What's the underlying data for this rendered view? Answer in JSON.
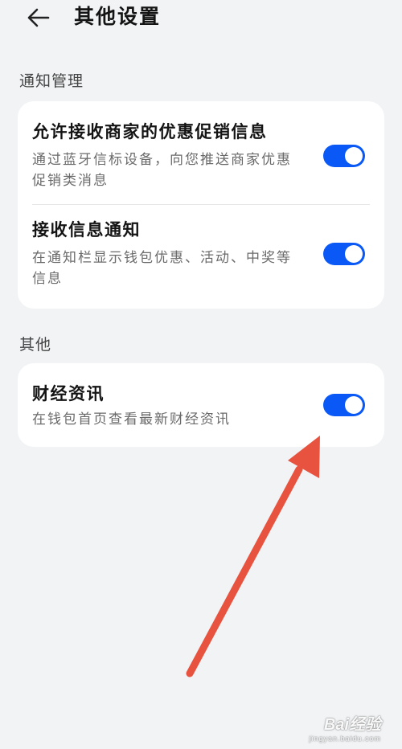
{
  "header": {
    "title": "其他设置",
    "back_icon": "arrow-left-icon"
  },
  "sections": [
    {
      "title": "通知管理",
      "items": [
        {
          "title": "允许接收商家的优惠促销信息",
          "description": "通过蓝牙信标设备，向您推送商家优惠促销类消息",
          "enabled": true
        },
        {
          "title": "接收信息通知",
          "description": "在通知栏显示钱包优惠、活动、中奖等信息",
          "enabled": true
        }
      ]
    },
    {
      "title": "其他",
      "items": [
        {
          "title": "财经资讯",
          "description": "在钱包首页查看最新财经资讯",
          "enabled": true
        }
      ]
    }
  ],
  "annotation": {
    "arrow_color": "#e8533f",
    "target": "财经资讯 toggle"
  },
  "colors": {
    "toggle_on": "#0a59f7",
    "background": "#f1f3f5",
    "card": "#ffffff"
  },
  "watermark": {
    "main": "Bai经验",
    "sub": "jingyan.baidu.com"
  }
}
